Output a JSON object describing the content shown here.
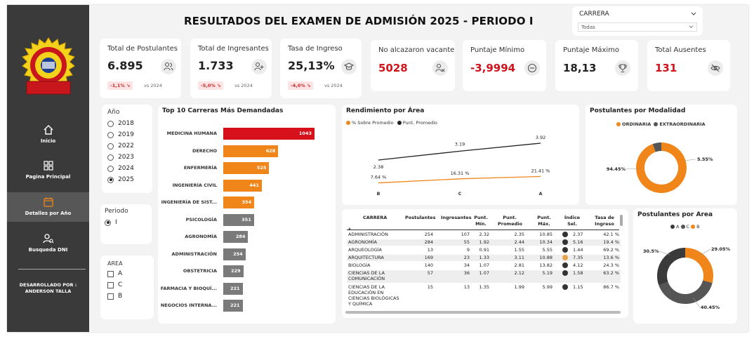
{
  "title": "RESULTADOS DEL EXAMEN DE ADMISIÓN 2025 - PERIODO I",
  "sidebar": {
    "items": [
      {
        "label": "Inicio"
      },
      {
        "label": "Pagina Principal"
      },
      {
        "label": "Detalles por Año"
      },
      {
        "label": "Busqueda DNI"
      }
    ],
    "dev_line1": "DESARROLLADO POR :",
    "dev_line2": "ANDERSON TALLA"
  },
  "carrera_filter": {
    "label": "CARRERA",
    "value": "Todas"
  },
  "kpis": [
    {
      "label": "Total de Postulantes",
      "value": "6.895",
      "badge": "-1,1% ↘",
      "vs": "vs 2024"
    },
    {
      "label": "Total de Ingresantes",
      "value": "1.733",
      "badge": "-5,0% ↘",
      "vs": "vs 2024"
    },
    {
      "label": "Tasa de Ingreso",
      "value": "25,13%",
      "badge": "-4,0% ↘",
      "vs": "vs 2024"
    },
    {
      "label": "No alcazaron vacante",
      "value": "5028"
    },
    {
      "label": "Puntaje Mínimo",
      "value": "-3,9994"
    },
    {
      "label": "Puntaje Máximo",
      "value": "18,13"
    },
    {
      "label": "Total Ausentes",
      "value": "131"
    }
  ],
  "year_slicer": {
    "title": "Año",
    "options": [
      "2018",
      "2019",
      "2022",
      "2023",
      "2024",
      "2025"
    ],
    "selected": "2025"
  },
  "periodo_slicer": {
    "title": "Periodo",
    "options": [
      "I"
    ],
    "selected": "I"
  },
  "area_slicer": {
    "title": "AREA",
    "options": [
      "A",
      "C",
      "B"
    ]
  },
  "top10": {
    "title": "Top 10 Carreras Más Demandadas",
    "bars": [
      {
        "label": "MEDICINA HUMANA",
        "value": 1043,
        "color": "#d6111c"
      },
      {
        "label": "DERECHO",
        "value": 628,
        "color": "#f08519"
      },
      {
        "label": "ENFERMERÍA",
        "value": 525,
        "color": "#f08519"
      },
      {
        "label": "INGENIERÍA CIVIL",
        "value": 441,
        "color": "#f08519"
      },
      {
        "label": "INGENIERÍA DE SIST...",
        "value": 354,
        "color": "#f08519"
      },
      {
        "label": "PSICOLOGÍA",
        "value": 351,
        "color": "#7a7a7a"
      },
      {
        "label": "AGRONOMÍA",
        "value": 284,
        "color": "#7a7a7a"
      },
      {
        "label": "ADMINISTRACIÓN",
        "value": 254,
        "color": "#7a7a7a"
      },
      {
        "label": "OBSTETRICIA",
        "value": 229,
        "color": "#7a7a7a"
      },
      {
        "label": "FARMACIA Y BIOQUÍ...",
        "value": 221,
        "color": "#7a7a7a"
      },
      {
        "label": "NEGOCIOS INTERNA...",
        "value": 221,
        "color": "#7a7a7a"
      }
    ]
  },
  "chart_data": [
    {
      "type": "line",
      "title": "Rendimiento por Área",
      "categories": [
        "B",
        "C",
        "A"
      ],
      "series": [
        {
          "name": "% Sobre Promedio",
          "values": [
            7.64,
            16.31,
            21.41
          ],
          "labels": [
            "7.64 %",
            "16.31 %",
            "21.41 %"
          ],
          "color": "#f08519"
        },
        {
          "name": "Punt. Promedio",
          "values": [
            2.38,
            3.19,
            3.92
          ],
          "labels": [
            "2.38",
            "3.19",
            "3.92"
          ],
          "color": "#222222"
        }
      ]
    },
    {
      "type": "pie",
      "title": "Postulantes por Modalidad",
      "legend": [
        "ORDINARIA",
        "EXTRAORDINARIA"
      ],
      "values": [
        94.45,
        5.55
      ],
      "labels": [
        "94.45%",
        "5.55%"
      ],
      "colors": [
        "#f08519",
        "#555555"
      ]
    },
    {
      "type": "pie",
      "title": "Postulantes por Area",
      "legend": [
        "A",
        "C",
        "B"
      ],
      "values": [
        30.5,
        40.45,
        29.05
      ],
      "labels": [
        "30.5%",
        "40.45%",
        "29.05%"
      ],
      "colors": [
        "#3a3a3a",
        "#555555",
        "#f08519"
      ]
    }
  ],
  "table": {
    "headers": [
      "CARRERA",
      "Postulantes",
      "Ingresantes",
      "Punt. Mín.",
      "Punt. Promedio",
      "Punt. Máx.",
      "Índice Sel.",
      "Tasa de Ingreso"
    ],
    "rows": [
      [
        "ADMINISTRACIÓN",
        "254",
        "107",
        "2.32",
        "2.35",
        "10.85",
        "2.37",
        "42.1 %"
      ],
      [
        "AGRONOMÍA",
        "284",
        "55",
        "1.92",
        "2.44",
        "10.34",
        "5.16",
        "19.4 %"
      ],
      [
        "ARQUEOLOGÍA",
        "13",
        "9",
        "0.91",
        "1.55",
        "5.55",
        "1.44",
        "69.2 %"
      ],
      [
        "ARQUITECTURA",
        "169",
        "23",
        "1.33",
        "3.11",
        "10.88",
        "7.35",
        "13.6 %"
      ],
      [
        "BIOLOGÍA",
        "140",
        "34",
        "1.07",
        "2.81",
        "13.82",
        "4.12",
        "24.3 %"
      ],
      [
        "CIENCIAS DE LA COMUNICACIÓN",
        "57",
        "36",
        "1.07",
        "2.12",
        "5.19",
        "1.58",
        "63.2 %"
      ],
      [
        "CIENCIAS DE LA EDUCACIÓN EN CIENCIAS BIOLÓGICAS Y QUÍMICA",
        "15",
        "13",
        "1.35",
        "1.99",
        "5.99",
        "1.15",
        "86.7 %"
      ]
    ],
    "dot_colors": [
      "#333333",
      "#333333",
      "#333333",
      "#e8a34a",
      "#333333",
      "#333333",
      "#333333"
    ]
  }
}
